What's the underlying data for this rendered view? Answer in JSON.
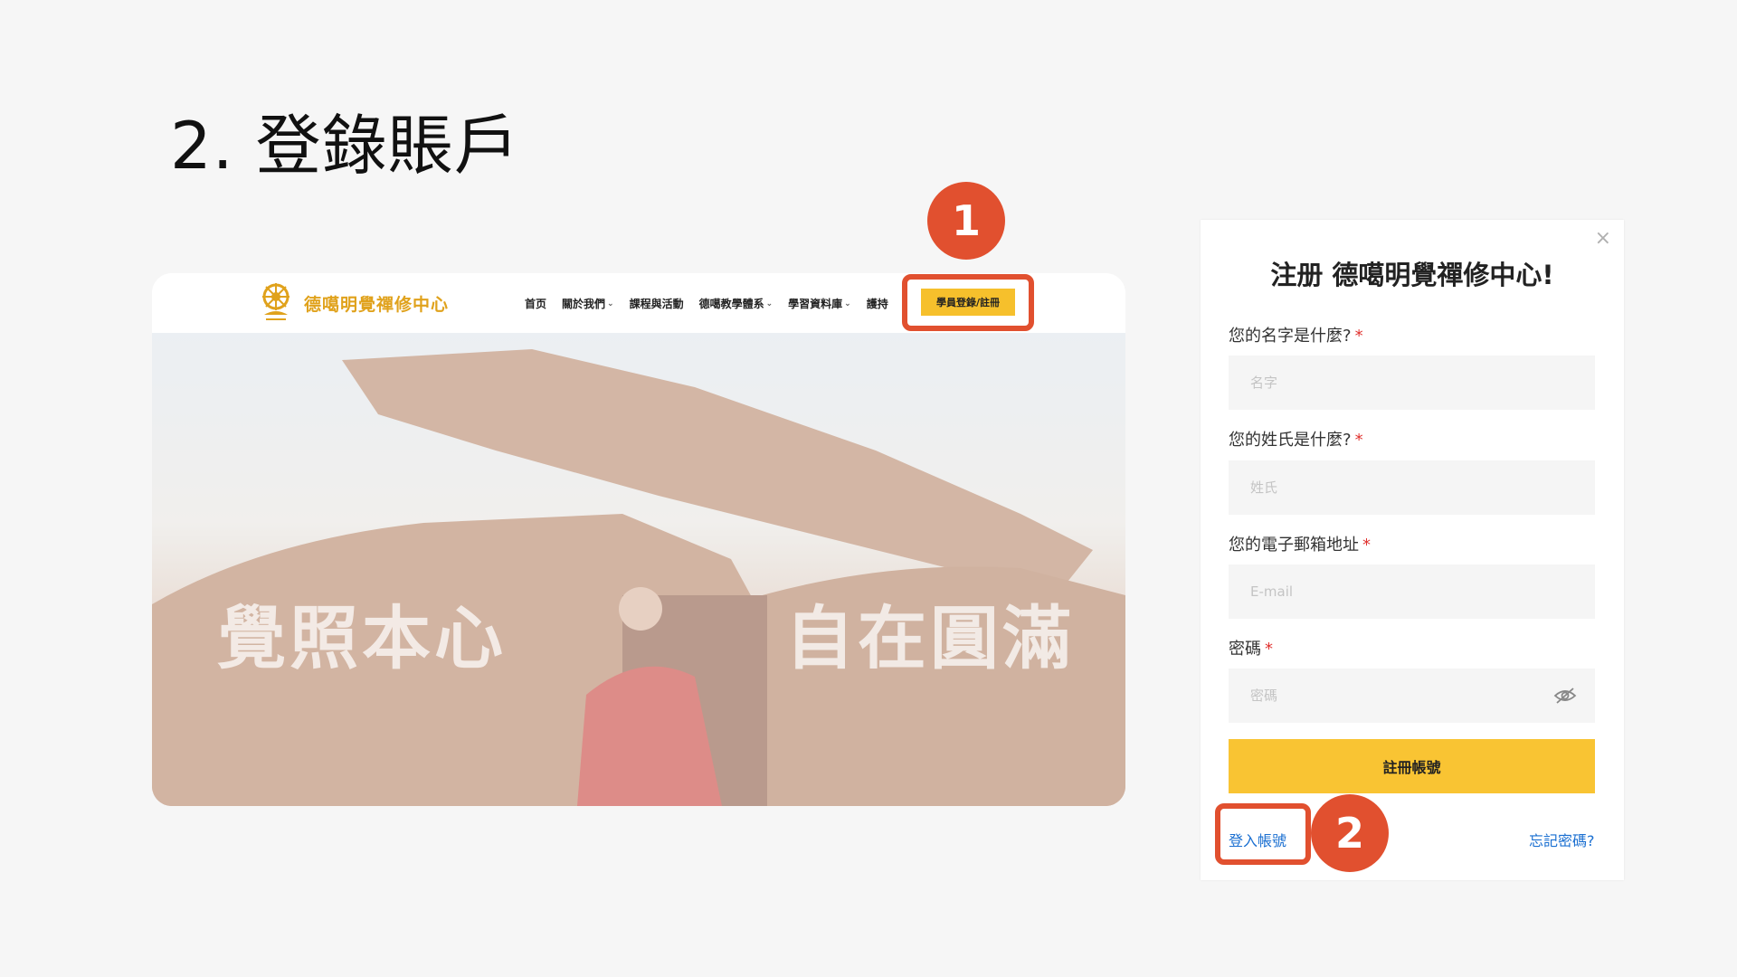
{
  "slide": {
    "title": "2. 登錄賬戶"
  },
  "site": {
    "logo_text": "德噶明覺禪修中心",
    "nav": [
      {
        "label": "首页",
        "dropdown": false
      },
      {
        "label": "關於我們",
        "dropdown": true
      },
      {
        "label": "課程與活動",
        "dropdown": false
      },
      {
        "label": "德噶教學體系",
        "dropdown": true
      },
      {
        "label": "學習資料庫",
        "dropdown": true
      },
      {
        "label": "護持",
        "dropdown": false
      }
    ],
    "register_button": "學員登錄/註冊",
    "hero_left": "覺照本心",
    "hero_right": "自在圓滿"
  },
  "callouts": {
    "one": "1",
    "two": "2",
    "color": "#e1502f"
  },
  "modal": {
    "close": "×",
    "title": "注册 德噶明覺禪修中心!",
    "fields": [
      {
        "label": "您的名字是什麼?",
        "required": "*",
        "placeholder": "名字"
      },
      {
        "label": "您的姓氏是什麼?",
        "required": "*",
        "placeholder": "姓氏"
      },
      {
        "label": "您的電子郵箱地址",
        "required": "*",
        "placeholder": "E-mail"
      },
      {
        "label": "密碼",
        "required": "*",
        "placeholder": "密碼"
      }
    ],
    "submit": "註冊帳號",
    "login_link": "登入帳號",
    "forgot_link": "忘記密碼?",
    "accent": "#f9c433"
  }
}
